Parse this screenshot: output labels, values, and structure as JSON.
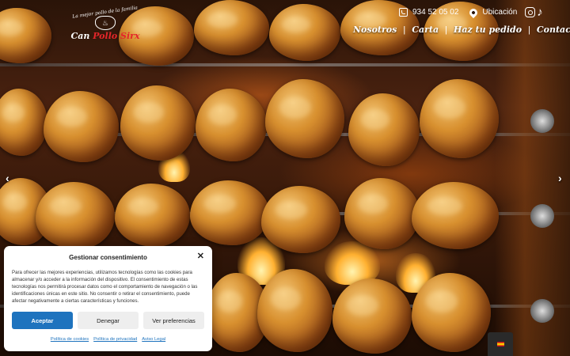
{
  "header": {
    "logo": {
      "tagline": "La mejor pollo de la familia",
      "brand_prefix": "Can ",
      "brand_accent": "Pollo Sirx"
    },
    "phone": "934 52 05 02",
    "location_label": "Ubicación",
    "icons": [
      "phone-icon",
      "pin-icon",
      "instagram-icon",
      "tiktok-icon"
    ]
  },
  "nav": {
    "items": [
      {
        "label": "Nosotros"
      },
      {
        "label": "Carta"
      },
      {
        "label": "Haz tu pedido"
      },
      {
        "label": "Contacto"
      }
    ],
    "separator": "|"
  },
  "slider": {
    "prev_icon": "‹",
    "next_icon": "›"
  },
  "consent": {
    "title": "Gestionar consentimiento",
    "body": "Para ofrecer las mejores experiencias, utilizamos tecnologías como las cookies para almacenar y/o acceder a la información del dispositivo. El consentimiento de estas tecnologías nos permitirá procesar datos como el comportamiento de navegación o las identificaciones únicas en este sitio. No consentir o retirar el consentimiento, puede afectar negativamente a ciertas características y funciones.",
    "accept_label": "Aceptar",
    "deny_label": "Denegar",
    "prefs_label": "Ver preferencias",
    "links": [
      "Política de cookies",
      "Política de privacidad",
      "Aviso Legal"
    ],
    "close_icon": "✕"
  },
  "colors": {
    "accent": "#1e73be",
    "brand_red": "#e5262a"
  }
}
